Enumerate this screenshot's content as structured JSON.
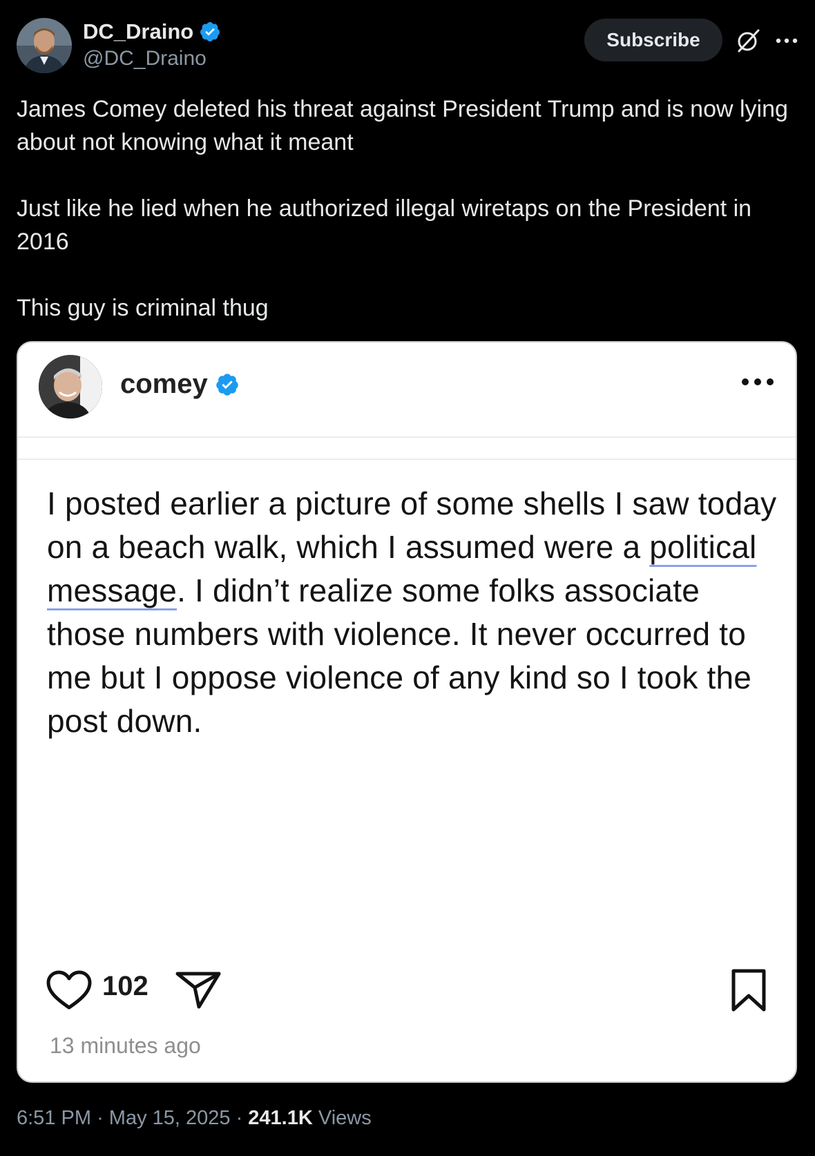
{
  "header": {
    "display_name": "DC_Draino",
    "handle": "@DC_Draino",
    "subscribe_label": "Subscribe"
  },
  "post": {
    "paragraphs": [
      "James Comey deleted his threat against President Trump and is now lying about not knowing what it meant",
      "Just like he lied when he authorized illegal wiretaps on the President in 2016",
      "This guy is criminal thug"
    ]
  },
  "embedded": {
    "username": "comey",
    "body_part1": "I posted earlier a picture of some shells I saw today on a beach walk, which I assumed were a ",
    "body_link1": "political",
    "body_link2": "message",
    "body_part2": ". I didn’t realize some folks associate those numbers with violence. It never occurred to me but I oppose violence of any kind so I took the post down.",
    "like_count": "102",
    "time_ago": "13 minutes ago"
  },
  "footer": {
    "time": "6:51 PM",
    "date": "May 15, 2025",
    "views_count": "241.1K",
    "views_label": "Views"
  },
  "colors": {
    "background": "#000000",
    "verified": "#1d9bf0",
    "text_primary": "#e7e9ea",
    "text_secondary": "#8b98a5"
  }
}
